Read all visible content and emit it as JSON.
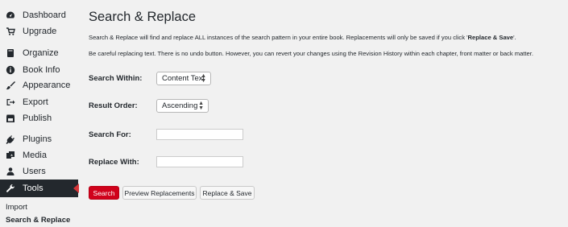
{
  "sidebar": {
    "items": [
      {
        "label": "Dashboard",
        "icon": "dashboard-icon"
      },
      {
        "label": "Upgrade",
        "icon": "cart-icon"
      },
      {
        "label": "Organize",
        "icon": "book-icon"
      },
      {
        "label": "Book Info",
        "icon": "info-icon"
      },
      {
        "label": "Appearance",
        "icon": "paintbrush-icon"
      },
      {
        "label": "Export",
        "icon": "export-icon"
      },
      {
        "label": "Publish",
        "icon": "store-icon"
      },
      {
        "label": "Plugins",
        "icon": "plug-icon"
      },
      {
        "label": "Media",
        "icon": "media-icon"
      },
      {
        "label": "Users",
        "icon": "users-icon"
      },
      {
        "label": "Tools",
        "icon": "wrench-icon"
      }
    ],
    "submenu": [
      {
        "label": "Import"
      },
      {
        "label": "Search & Replace"
      }
    ]
  },
  "main": {
    "title": "Search & Replace",
    "desc1_prefix": "Search & Replace will find and replace ALL instances of the search pattern in your entire book. Replacements will only be saved if you click '",
    "desc1_bold": "Replace & Save",
    "desc1_suffix": "'.",
    "desc2": "Be careful replacing text. There is no undo button. However, you can revert your changes using the Revision History within each chapter, front matter or back matter.",
    "search_within": {
      "label": "Search Within:",
      "value": "Content Text"
    },
    "result_order": {
      "label": "Result Order:",
      "value": "Ascending"
    },
    "search_for": {
      "label": "Search For:",
      "value": ""
    },
    "replace_with": {
      "label": "Replace With:",
      "value": ""
    },
    "buttons": {
      "search": "Search",
      "preview": "Preview Replacements",
      "replace_save": "Replace & Save"
    }
  },
  "colors": {
    "accent": "#d0021b",
    "active_nav": "#23282d",
    "background": "#f1f1f1"
  }
}
